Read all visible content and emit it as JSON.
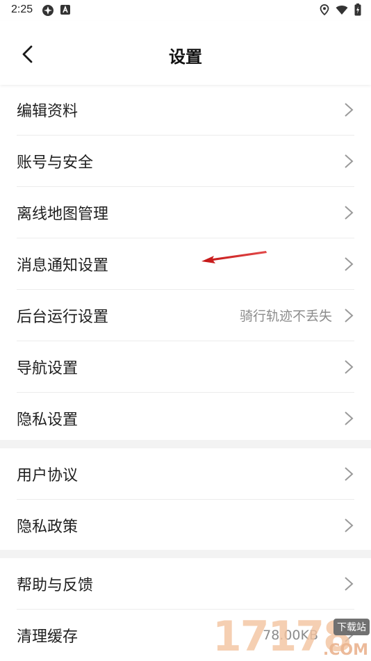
{
  "status_bar": {
    "time": "2:25"
  },
  "header": {
    "title": "设置"
  },
  "groups": [
    {
      "items": [
        {
          "label": "编辑资料"
        },
        {
          "label": "账号与安全"
        },
        {
          "label": "离线地图管理"
        },
        {
          "label": "消息通知设置"
        },
        {
          "label": "后台运行设置",
          "value": "骑行轨迹不丢失"
        },
        {
          "label": "导航设置"
        },
        {
          "label": "隐私设置"
        }
      ]
    },
    {
      "items": [
        {
          "label": "用户协议"
        },
        {
          "label": "隐私政策"
        }
      ]
    },
    {
      "items": [
        {
          "label": "帮助与反馈"
        },
        {
          "label": "清理缓存",
          "value": "78.00KB"
        }
      ]
    }
  ],
  "watermark": {
    "number": "17178",
    "tag": "下载站",
    "domain": ".COM"
  },
  "colors": {
    "annotation_arrow": "#d32020",
    "divider": "#f3f3f3"
  }
}
